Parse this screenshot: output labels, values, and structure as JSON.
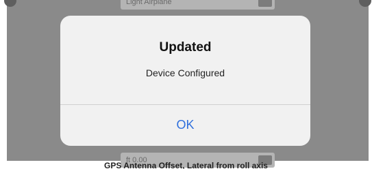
{
  "alert": {
    "title": "Updated",
    "message": "Device Configured",
    "ok_label": "OK"
  },
  "background": {
    "top_field_value": "Light Airplane",
    "bottom_field_value": "ft 0.00",
    "caption": "GPS Antenna Offset, Lateral from roll axis"
  },
  "colors": {
    "accent": "#2f6fdc",
    "dim_overlay": "#8a8a8a",
    "alert_background": "#f1f1f1"
  }
}
